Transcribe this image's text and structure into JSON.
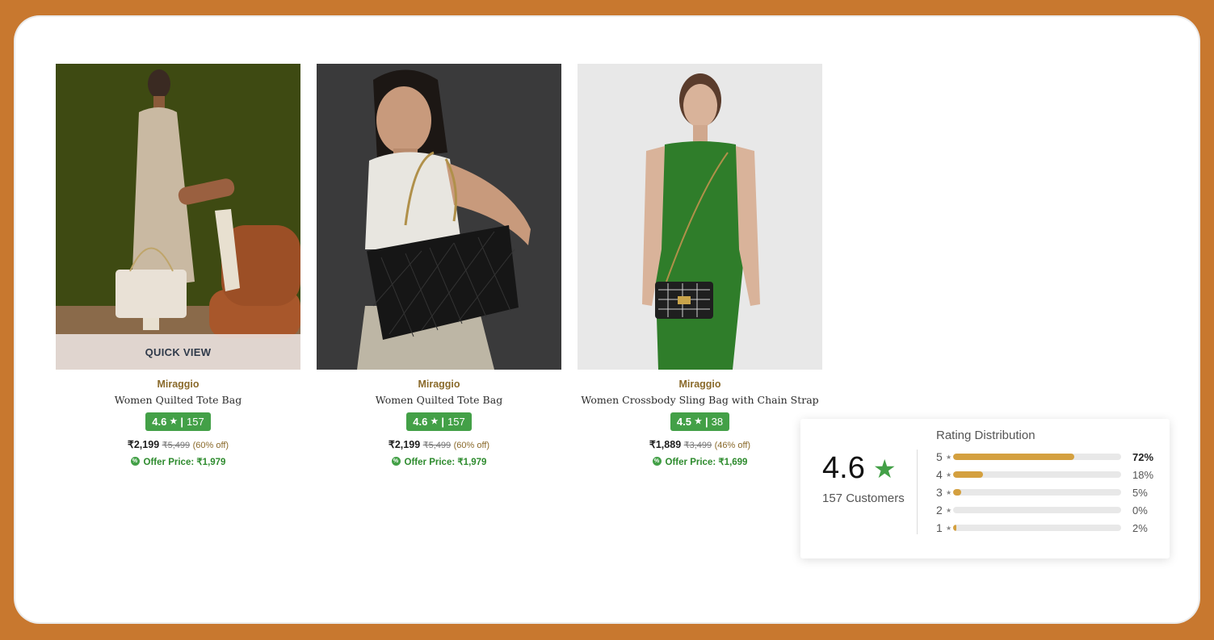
{
  "products": [
    {
      "brand": "Miraggio",
      "title": "Women Quilted Tote Bag",
      "rating": "4.6",
      "rating_count": "157",
      "price": "₹2,199",
      "mrp": "₹5,499",
      "discount": "(60% off)",
      "offer": "Offer Price: ₹1,979",
      "quick_view": "QUICK VIEW"
    },
    {
      "brand": "Miraggio",
      "title": "Women Quilted Tote Bag",
      "rating": "4.6",
      "rating_count": "157",
      "price": "₹2,199",
      "mrp": "₹5,499",
      "discount": "(60% off)",
      "offer": "Offer Price: ₹1,979"
    },
    {
      "brand": "Miraggio",
      "title": "Women Crossbody Sling Bag with Chain Strap",
      "rating": "4.5",
      "rating_count": "38",
      "price": "₹1,889",
      "mrp": "₹3,499",
      "discount": "(46% off)",
      "offer": "Offer Price: ₹1,699"
    }
  ],
  "rating_distribution": {
    "title": "Rating Distribution",
    "average": "4.6",
    "customers": "157 Customers",
    "rows": [
      {
        "level": "5",
        "percent": 72,
        "label": "72%"
      },
      {
        "level": "4",
        "percent": 18,
        "label": "18%"
      },
      {
        "level": "3",
        "percent": 5,
        "label": "5%"
      },
      {
        "level": "2",
        "percent": 0,
        "label": "0%"
      },
      {
        "level": "1",
        "percent": 2,
        "label": "2%"
      }
    ]
  },
  "colors": {
    "frame_bg": "#c8782f",
    "rating_green": "#43a047",
    "brand_gold": "#8a6a2b",
    "bar_gold": "#d4a03f"
  }
}
